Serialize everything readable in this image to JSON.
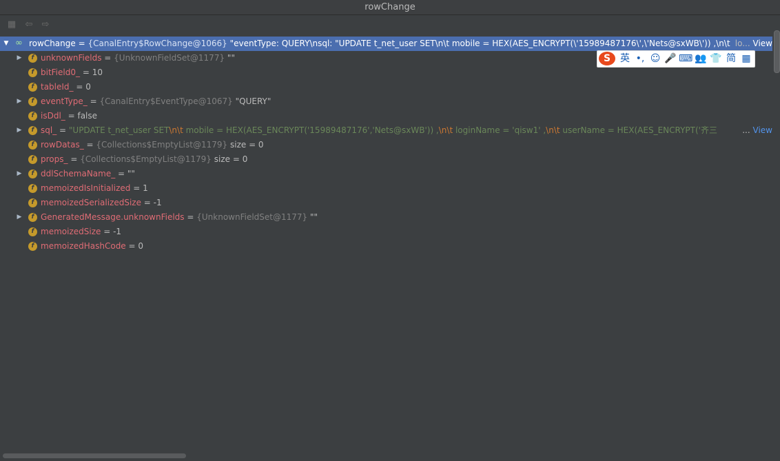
{
  "window": {
    "title": "rowChange"
  },
  "toolbar": {
    "buttons": [
      {
        "name": "collapse-icon"
      },
      {
        "name": "back-arrow-icon"
      },
      {
        "name": "forward-arrow-icon"
      }
    ]
  },
  "tree": {
    "root": {
      "name": "rowChange",
      "type": "{CanalEntry$RowChange@1066}",
      "value_a": "\"eventType: QUERY\\nsql: \"UPDATE t_net_user SET\\n\\t        mobile = HEX(AES_ENCRYPT(\\'15989487176\\',\\'Nets@sxWB\\')) ,\\n\\t",
      "ellipsis": "lo...",
      "view": "View"
    },
    "fields": [
      {
        "name": "unknownFields",
        "type": "{UnknownFieldSet@1177}",
        "value": "\"\"",
        "expandable": true
      },
      {
        "name": "bitField0_",
        "type": "",
        "value": "10",
        "expandable": false
      },
      {
        "name": "tableId_",
        "type": "",
        "value": "0",
        "expandable": false
      },
      {
        "name": "eventType_",
        "type": "{CanalEntry$EventType@1067}",
        "value": "\"QUERY\"",
        "expandable": true
      },
      {
        "name": "isDdl_",
        "type": "",
        "value": "false",
        "expandable": false
      },
      {
        "name": "sql_",
        "type": "",
        "value": "",
        "expandable": true
      },
      {
        "name": "rowDatas_",
        "type": "{Collections$EmptyList@1179}",
        "value": "size = 0",
        "expandable": false
      },
      {
        "name": "props_",
        "type": "{Collections$EmptyList@1179}",
        "value": "size = 0",
        "expandable": false
      },
      {
        "name": "ddlSchemaName_",
        "type": "",
        "value": "\"\"",
        "expandable": true
      },
      {
        "name": "memoizedIsInitialized",
        "type": "",
        "value": "1",
        "expandable": false
      },
      {
        "name": "memoizedSerializedSize",
        "type": "",
        "value": "-1",
        "expandable": false
      },
      {
        "name": "GeneratedMessage.unknownFields",
        "type": "{UnknownFieldSet@1177}",
        "value": "\"\"",
        "expandable": true
      },
      {
        "name": "memoizedSize",
        "type": "",
        "value": "-1",
        "expandable": false
      },
      {
        "name": "memoizedHashCode",
        "type": "",
        "value": "0",
        "expandable": false
      }
    ],
    "sql_parts": {
      "s1": "\"UPDATE t_net_user SET",
      "e1": "\\n\\t",
      "s2": "        mobile = HEX(AES_ENCRYPT('15989487176','Nets@sxWB')) ,",
      "e2": "\\n\\t",
      "s3": "        loginName = 'qisw1' ,",
      "e3": "\\n\\t",
      "s4": "        userName = HEX(AES_ENCRYPT('齐三",
      "ellipsis": "...",
      "view": "View"
    }
  },
  "ime": {
    "logo": "S",
    "items": [
      "英",
      "•,",
      "☺",
      "🎤",
      "⌨",
      "👥",
      "👕",
      "简",
      "▦"
    ]
  }
}
